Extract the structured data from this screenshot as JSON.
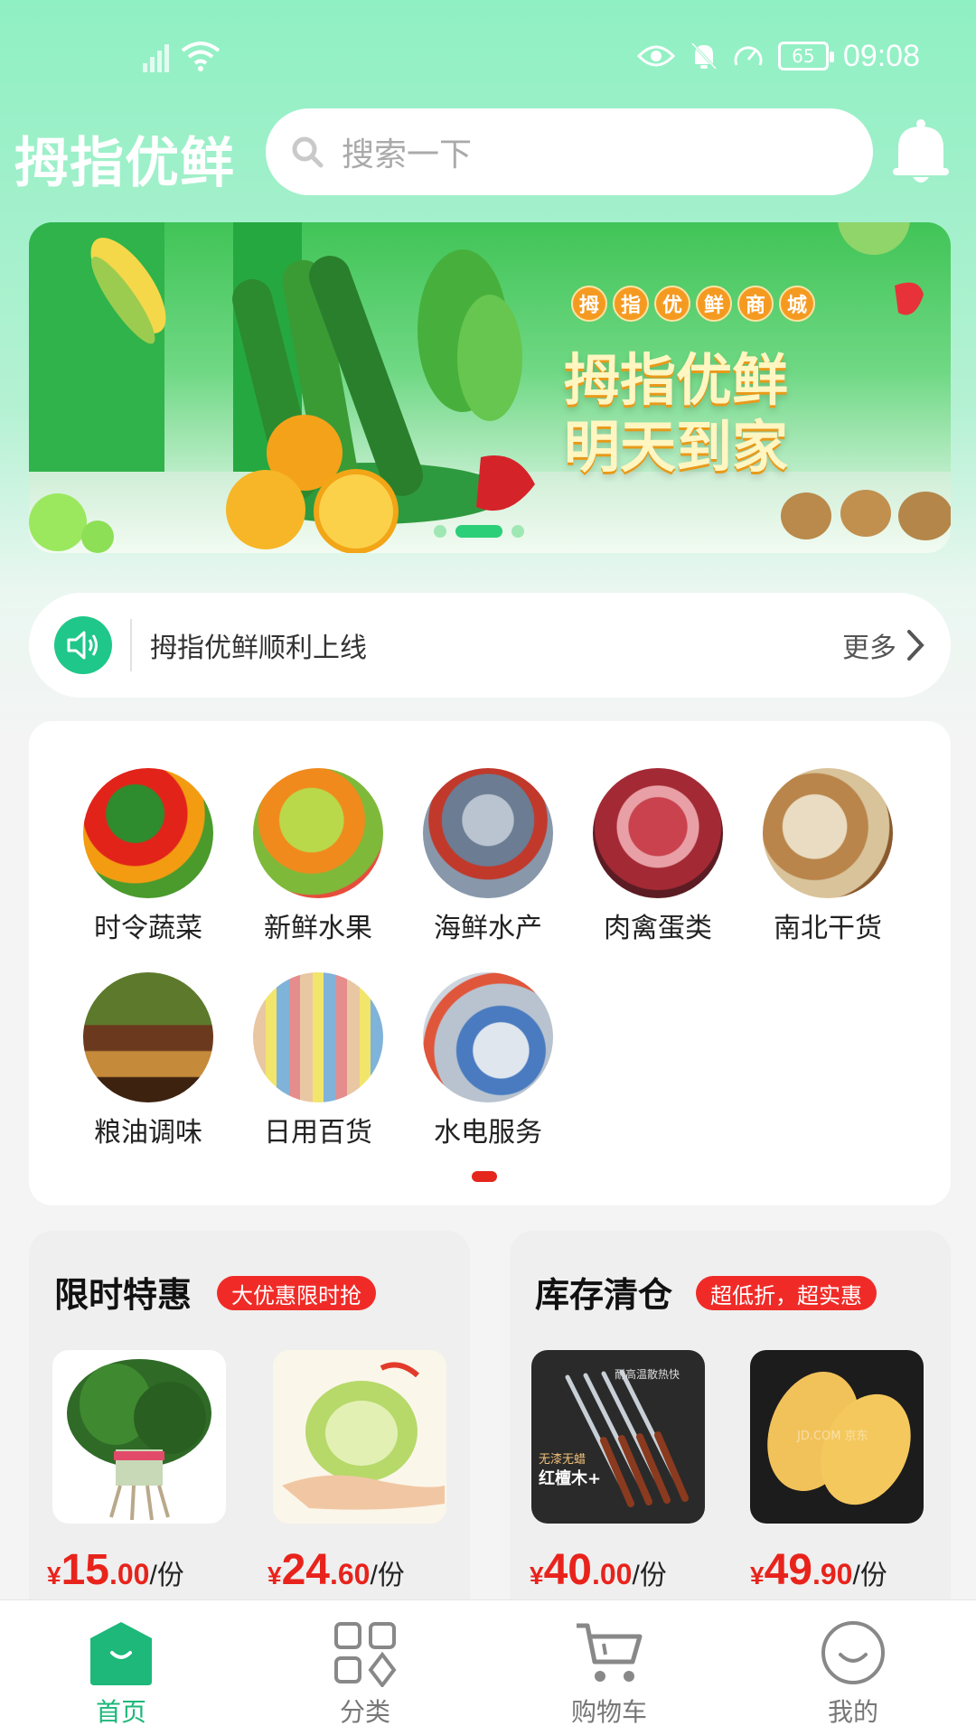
{
  "status_bar": {
    "battery": "65",
    "time": "09:08"
  },
  "header": {
    "brand": "拇指优鲜",
    "search_placeholder": "搜索一下"
  },
  "banner": {
    "badge_chars": [
      "拇",
      "指",
      "优",
      "鲜",
      "商",
      "城"
    ],
    "line1": "拇指优鲜",
    "line2": "明天到家"
  },
  "notice": {
    "text": "拇指优鲜顺利上线",
    "more_label": "更多"
  },
  "categories": [
    {
      "label": "时令蔬菜",
      "icon": "vegetables-photo"
    },
    {
      "label": "新鲜水果",
      "icon": "fruits-photo"
    },
    {
      "label": "海鲜水产",
      "icon": "seafood-photo"
    },
    {
      "label": "肉禽蛋类",
      "icon": "meat-photo"
    },
    {
      "label": "南北干货",
      "icon": "dried-goods-photo"
    },
    {
      "label": "粮油调味",
      "icon": "grain-oil-photo"
    },
    {
      "label": "日用百货",
      "icon": "daily-goods-photo"
    },
    {
      "label": "水电服务",
      "icon": "utility-service-photo"
    }
  ],
  "promos": [
    {
      "title": "限时特惠",
      "badge": "大优惠限时抢",
      "products": [
        {
          "image": "spinach",
          "currency": "¥",
          "int": "15",
          "dec": ".00",
          "unit": "/份"
        },
        {
          "image": "cabbage",
          "currency": "¥",
          "int": "24",
          "dec": ".60",
          "unit": "/份"
        }
      ]
    },
    {
      "title": "库存清仓",
      "badge": "超低折，超实惠",
      "products": [
        {
          "image": "chopsticks",
          "currency": "¥",
          "int": "40",
          "dec": ".00",
          "unit": "/份",
          "img_text": [
            "耐高温散热快",
            "无漆无蜡",
            "红檀木+"
          ]
        },
        {
          "image": "mango",
          "currency": "¥",
          "int": "49",
          "dec": ".90",
          "unit": "/份",
          "img_text": [
            "JD.COM 京东"
          ]
        }
      ]
    }
  ],
  "tabbar": [
    {
      "label": "首页",
      "icon": "home-icon",
      "active": true
    },
    {
      "label": "分类",
      "icon": "category-icon",
      "active": false
    },
    {
      "label": "购物车",
      "icon": "cart-icon",
      "active": false
    },
    {
      "label": "我的",
      "icon": "profile-icon",
      "active": false
    }
  ],
  "colors": {
    "accent": "#1db87a",
    "price": "#e8231c",
    "badge": "#f02b27",
    "header_bg": "#8ff0c3"
  }
}
